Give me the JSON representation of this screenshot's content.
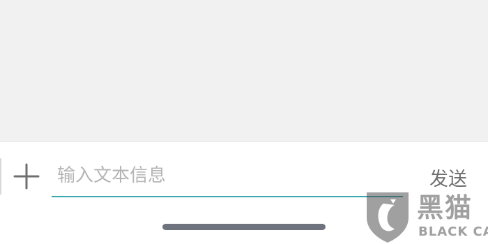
{
  "composer": {
    "plus_icon": "plus-icon",
    "input_value": "",
    "input_placeholder": "输入文本信息",
    "send_label": "发送",
    "accent_color": "#3aa6ad"
  },
  "watermark": {
    "logo_icon": "black-cat-shield-icon",
    "text_cn": "黑猫",
    "text_en": "BLACK CAT"
  }
}
